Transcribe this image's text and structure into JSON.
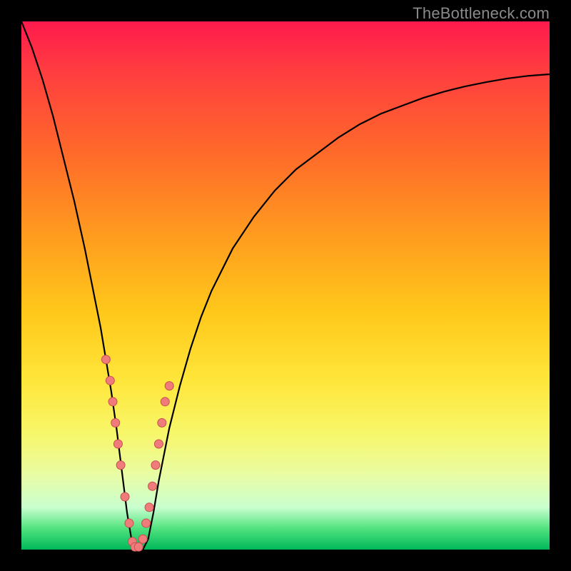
{
  "watermark": "TheBottleneck.com",
  "colors": {
    "frame": "#000000",
    "curve": "#000000",
    "dot_fill": "#ef7b7b",
    "dot_stroke": "#c94f4f"
  },
  "chart_data": {
    "type": "line",
    "title": "",
    "xlabel": "",
    "ylabel": "",
    "xlim": [
      0,
      100
    ],
    "ylim": [
      0,
      100
    ],
    "grid": false,
    "legend": false,
    "series": [
      {
        "name": "bottleneck-curve",
        "x": [
          0,
          2,
          4,
          6,
          8,
          10,
          12,
          14,
          15,
          16,
          17,
          18,
          19,
          20,
          21,
          22,
          23,
          24,
          25,
          26,
          27,
          28,
          30,
          32,
          34,
          36,
          38,
          40,
          44,
          48,
          52,
          56,
          60,
          64,
          68,
          72,
          76,
          80,
          84,
          88,
          92,
          96,
          100
        ],
        "y": [
          100,
          95,
          89,
          82,
          74,
          66,
          57,
          47,
          42,
          36,
          30,
          23,
          15,
          7,
          1,
          0,
          0,
          2,
          7,
          13,
          18,
          23,
          31,
          38,
          44,
          49,
          53,
          57,
          63,
          68,
          72,
          75,
          78,
          80.5,
          82.5,
          84,
          85.5,
          86.7,
          87.7,
          88.5,
          89.2,
          89.7,
          90
        ]
      }
    ],
    "points": [
      {
        "x": 16.0,
        "y": 36
      },
      {
        "x": 16.8,
        "y": 32
      },
      {
        "x": 17.3,
        "y": 28
      },
      {
        "x": 17.8,
        "y": 24
      },
      {
        "x": 18.3,
        "y": 20
      },
      {
        "x": 18.8,
        "y": 16
      },
      {
        "x": 19.6,
        "y": 10
      },
      {
        "x": 20.4,
        "y": 5
      },
      {
        "x": 21.0,
        "y": 1.5
      },
      {
        "x": 21.5,
        "y": 0.5
      },
      {
        "x": 22.2,
        "y": 0.5
      },
      {
        "x": 23.0,
        "y": 2
      },
      {
        "x": 23.6,
        "y": 5
      },
      {
        "x": 24.2,
        "y": 8
      },
      {
        "x": 24.8,
        "y": 12
      },
      {
        "x": 25.4,
        "y": 16
      },
      {
        "x": 26.0,
        "y": 20
      },
      {
        "x": 26.6,
        "y": 24
      },
      {
        "x": 27.2,
        "y": 28
      },
      {
        "x": 28.0,
        "y": 31
      }
    ],
    "dot_radius_px": 6
  }
}
